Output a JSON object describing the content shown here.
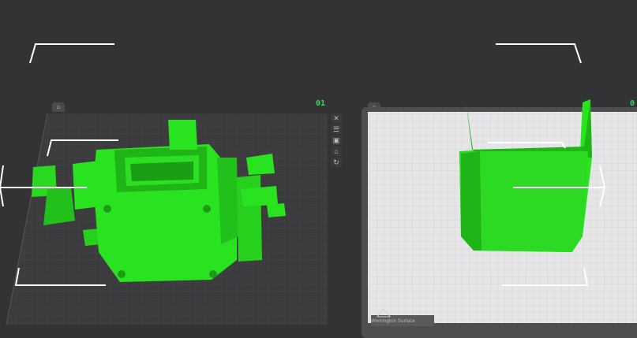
{
  "plates": [
    {
      "number": "01"
    },
    {
      "number": "0"
    }
  ],
  "bed": {
    "brand_label": "Wemington Surface"
  },
  "tools": {
    "icons": [
      "cross-icon",
      "layers-icon",
      "cube-icon",
      "printer-icon",
      "orbit-icon"
    ],
    "glyphs": [
      "✕",
      "☰",
      "▣",
      "⌂",
      "↻"
    ]
  },
  "colors": {
    "background": "#333335",
    "model_green": "#29e320",
    "plate_number": "#3fd85a",
    "guide_white": "#ffffff"
  }
}
